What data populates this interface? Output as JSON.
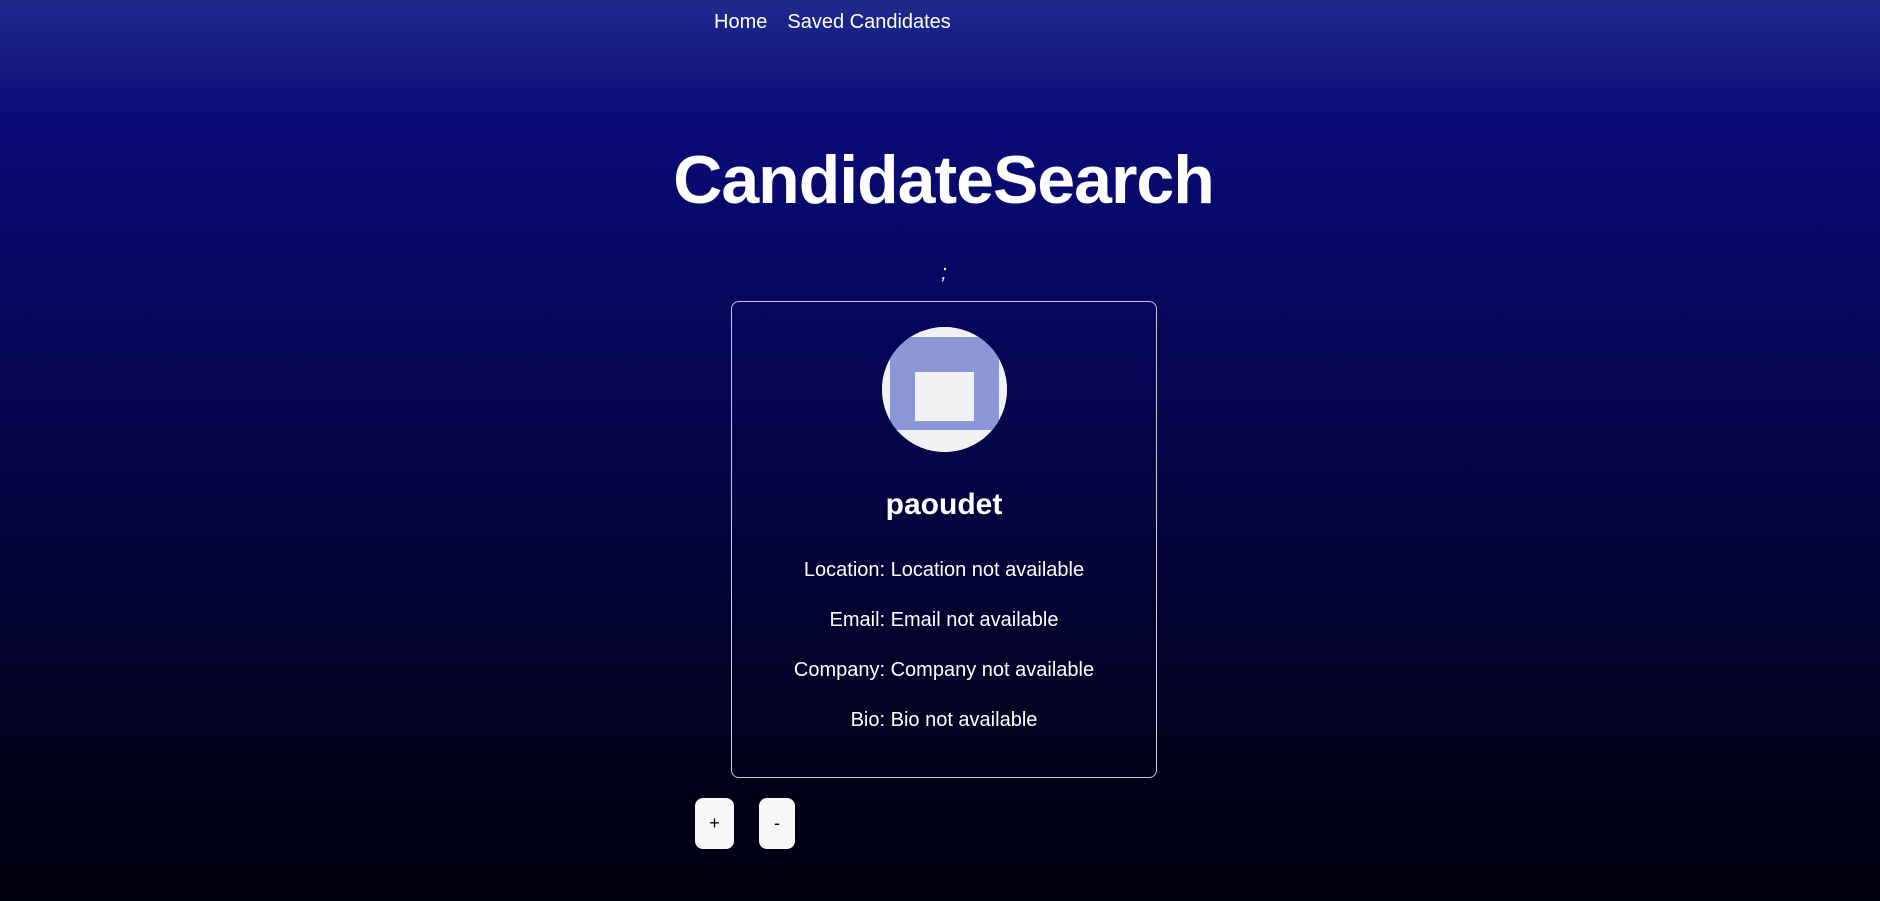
{
  "nav": {
    "home_label": "Home",
    "saved_label": "Saved Candidates"
  },
  "header": {
    "title": "CandidateSearch",
    "separator": ";"
  },
  "candidate": {
    "username": "paoudet",
    "avatar_icon": "identicon-avatar",
    "location": "Location: Location not available",
    "email": "Email: Email not available",
    "company": "Company: Company not available",
    "bio": "Bio: Bio not available"
  },
  "actions": {
    "add_label": "+",
    "remove_label": "-"
  },
  "colors": {
    "avatar_block": "#8c97d8",
    "avatar_background": "#f1f1f3",
    "button_background": "#f7f7f7"
  }
}
